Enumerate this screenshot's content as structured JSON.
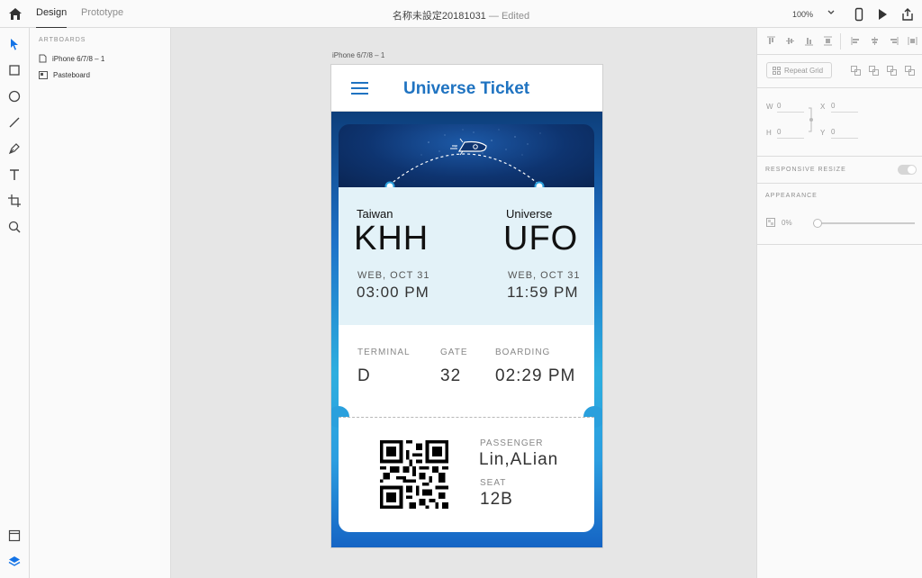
{
  "topbar": {
    "tab_design": "Design",
    "tab_prototype": "Prototype",
    "document_name": "名称未設定20181031",
    "separator": "—",
    "status": "Edited",
    "zoom": "100%"
  },
  "layers": {
    "heading": "ARTBOARDS",
    "items": [
      {
        "label": "iPhone 6/7/8 – 1",
        "icon": "artboard-icon"
      },
      {
        "label": "Pasteboard",
        "icon": "pasteboard-icon"
      }
    ]
  },
  "canvas": {
    "artboard_label": "iPhone 6/7/8 – 1"
  },
  "app": {
    "title": "Universe Ticket",
    "origin": {
      "city": "Taiwan",
      "code": "KHH",
      "date": "WEB, OCT 31",
      "time": "03:00 PM"
    },
    "destination": {
      "city": "Universe",
      "code": "UFO",
      "date": "WEB, OCT 31",
      "time": "11:59 PM"
    },
    "terminal_label": "TERMINAL",
    "terminal_value": "D",
    "gate_label": "GATE",
    "gate_value": "32",
    "boarding_label": "BOARDING",
    "boarding_value": "02:29 PM",
    "passenger_label": "PASSENGER",
    "passenger_value": "Lin,ALian",
    "seat_label": "SEAT",
    "seat_value": "12B"
  },
  "properties": {
    "repeat_grid": "Repeat Grid",
    "w_label": "W",
    "w_value": "0",
    "h_label": "H",
    "h_value": "0",
    "x_label": "X",
    "x_value": "0",
    "y_label": "Y",
    "y_value": "0",
    "responsive_resize": "RESPONSIVE RESIZE",
    "appearance": "APPEARANCE",
    "opacity": "0%"
  },
  "colors": {
    "brand": "#1f73c1",
    "ticket_info_bg": "#e3f2f8",
    "accent_cyan": "#2aa0dd"
  }
}
